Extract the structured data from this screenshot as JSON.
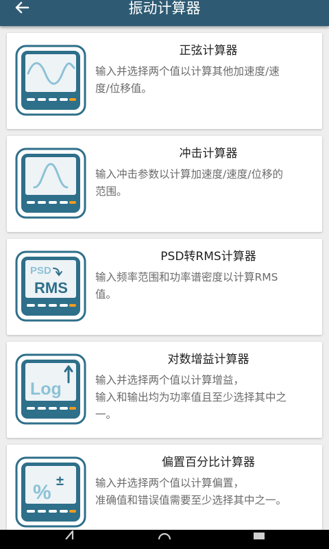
{
  "app_bar": {
    "title": "振动计算器",
    "back_icon": "arrow-left-icon"
  },
  "calculators": [
    {
      "title": "正弦计算器",
      "desc_lines": [
        "输入并选择两个值以计算其他加速度/速",
        "度/位移值。"
      ],
      "icon": "sine-wave-calculator-icon"
    },
    {
      "title": "冲击计算器",
      "desc_lines": [
        "输入冲击参数以计算加速度/速度/位移的",
        "范围。"
      ],
      "icon": "shock-pulse-calculator-icon"
    },
    {
      "title": "PSD转RMS计算器",
      "desc_lines": [
        "输入频率范围和功率谱密度以计算RMS",
        "值。"
      ],
      "icon": "psd-rms-calculator-icon",
      "icon_text": {
        "top": "PSD",
        "bottom": "RMS"
      }
    },
    {
      "title": "对数增益计算器",
      "desc_lines": [
        "输入并选择两个值以计算增益，",
        "输入和输出均为功率值且至少选择其中之",
        "一。"
      ],
      "icon": "log-gain-calculator-icon",
      "icon_text": {
        "main": "Log"
      }
    },
    {
      "title": "偏置百分比计算器",
      "desc_lines": [
        "输入并选择两个值以计算偏置，",
        "准确值和错误值需要至少选择其中之一。"
      ],
      "icon": "percent-offset-calculator-icon",
      "icon_text": {
        "main": "%",
        "sign": "±"
      }
    }
  ],
  "nav_bar": {
    "back": "nav-back-icon",
    "home": "nav-home-icon",
    "recents": "nav-recents-icon"
  },
  "colors": {
    "app_bar": "#2e5b73",
    "icon_frame": "#2e6f8a",
    "icon_screen": "#eef3f6",
    "icon_curve": "#8cc2d6",
    "icon_accent": "#f39c1f"
  }
}
